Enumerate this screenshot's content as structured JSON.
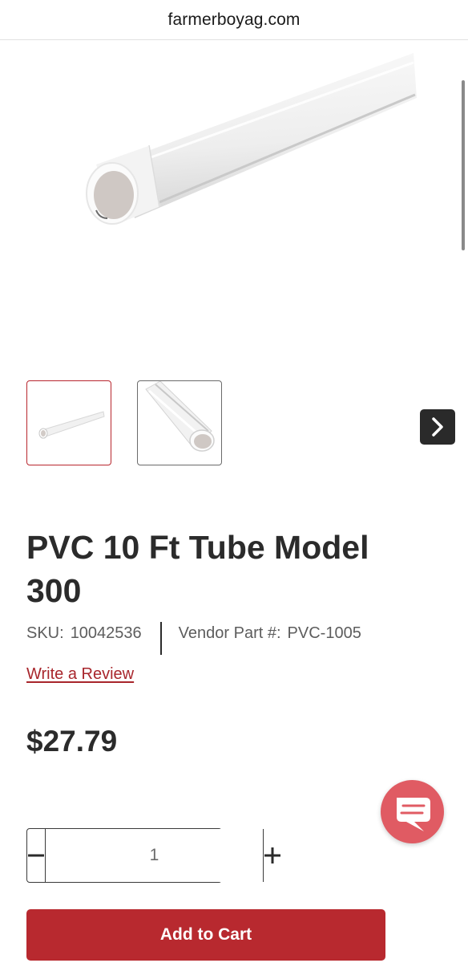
{
  "browser": {
    "url": "farmerboyag.com"
  },
  "gallery": {
    "thumbnail_count": 2,
    "selected_index": 0
  },
  "product": {
    "title": "PVC 10 Ft Tube Model 300",
    "sku_label": "SKU:",
    "sku_value": "10042536",
    "vendor_label": "Vendor Part #:",
    "vendor_value": "PVC-1005",
    "review_link": "Write a Review",
    "price": "$27.79"
  },
  "quantity": {
    "value": "1",
    "decrement_icon": "minus-icon",
    "increment_icon": "plus-icon"
  },
  "actions": {
    "add_to_cart": "Add to Cart"
  },
  "colors": {
    "accent": "#b8292f",
    "link": "#a8262c",
    "chat": "#e05b63"
  }
}
